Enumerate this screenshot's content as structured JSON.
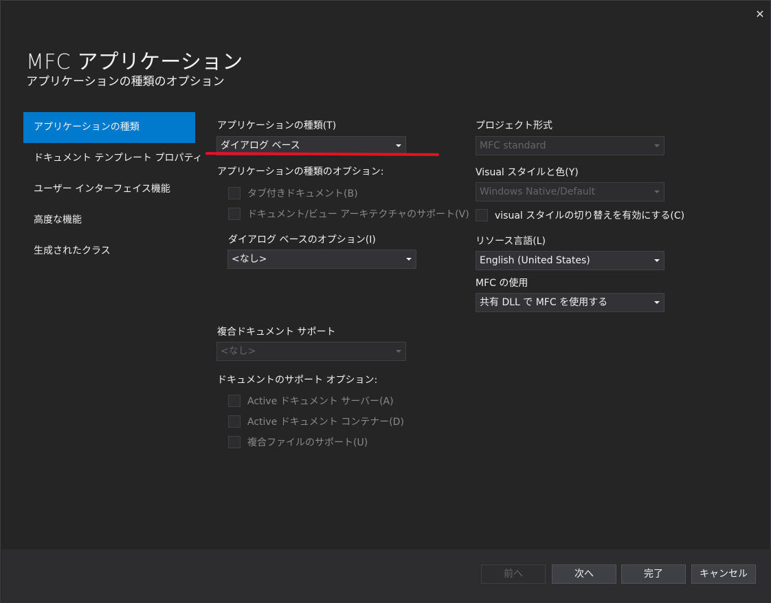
{
  "window": {
    "close_glyph": "✕"
  },
  "header": {
    "title": "MFC アプリケーション",
    "subtitle": "アプリケーションの種類のオプション"
  },
  "nav": {
    "items": [
      {
        "label": "アプリケーションの種類",
        "active": true
      },
      {
        "label": "ドキュメント テンプレート プロパティ"
      },
      {
        "label": "ユーザー インターフェイス機能"
      },
      {
        "label": "高度な機能"
      },
      {
        "label": "生成されたクラス"
      }
    ]
  },
  "left": {
    "app_type_label": "アプリケーションの種類(T)",
    "app_type_value": "ダイアログ ベース",
    "app_type_options_label": "アプリケーションの種類のオプション:",
    "tabbed_docs": "タブ付きドキュメント(B)",
    "doc_view_support": "ドキュメント/ビュー アーキテクチャのサポート(V)",
    "dialog_options_label": "ダイアログ ベースのオプション(I)",
    "dialog_options_value": "<なし>",
    "compound_label": "複合ドキュメント サポート",
    "compound_value": "<なし>",
    "doc_support_label": "ドキュメントのサポート オプション:",
    "active_doc_server": "Active ドキュメント サーバー(A)",
    "active_doc_container": "Active ドキュメント コンテナー(D)",
    "compound_file_support": "複合ファイルのサポート(U)"
  },
  "right": {
    "project_style_label": "プロジェクト形式",
    "project_style_value": "MFC standard",
    "visual_style_label": "Visual スタイルと色(Y)",
    "visual_style_value": "Windows Native/Default",
    "visual_switch": "visual スタイルの切り替えを有効にする(C)",
    "resource_lang_label": "リソース言語(L)",
    "resource_lang_value": "English (United States)",
    "mfc_use_label": "MFC の使用",
    "mfc_use_value": "共有 DLL で MFC を使用する"
  },
  "footer": {
    "prev": "前へ",
    "next": "次へ",
    "finish": "完了",
    "cancel": "キャンセル"
  },
  "colors": {
    "accent": "#007acc",
    "annotation": "#e81123"
  }
}
